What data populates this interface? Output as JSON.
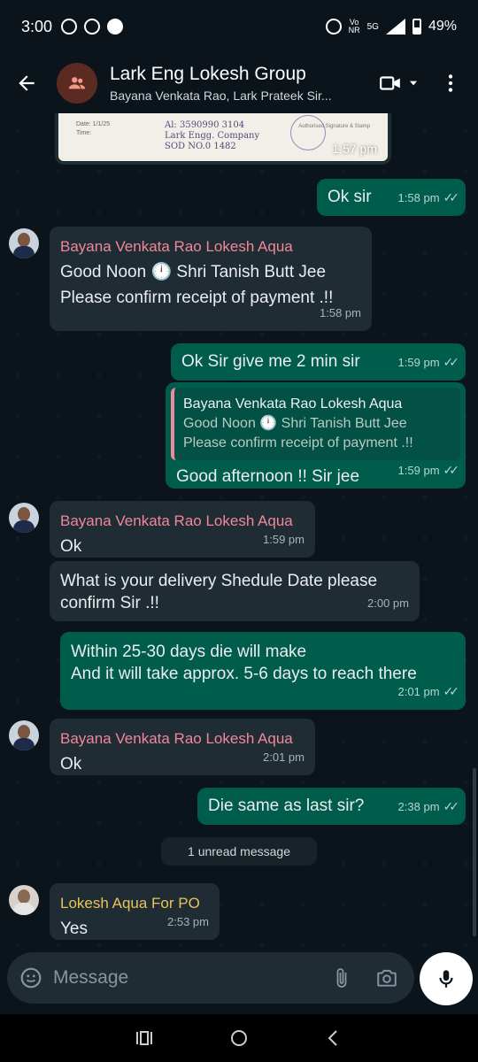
{
  "status_bar": {
    "time": "3:00",
    "network_label_1": "Vo",
    "network_label_2": "NR",
    "network_type": "5G",
    "battery": "49%"
  },
  "header": {
    "title": "Lark Eng Lokesh Group",
    "subtitle": "Bayana Venkata Rao, Lark Prateek Sir..."
  },
  "messages": [
    {
      "id": "img",
      "type": "image",
      "time": "1:57 pm",
      "image_text": "Al: 3590990 3104",
      "image_text2": "Lark Engg. Company",
      "image_text3": "SOD NO.0 1482",
      "date_label": "Date: 1/1/25",
      "time_label": "Time:",
      "sig_label": "Authorised Signature & Stamp"
    },
    {
      "id": "m1",
      "type": "out",
      "text": "Ok sir",
      "time": "1:58 pm"
    },
    {
      "id": "m2",
      "type": "in",
      "sender": "Bayana Venkata Rao Lokesh Aqua",
      "line1": "Good Noon 🕛 Shri Tanish Butt Jee",
      "line2": "Please confirm receipt of payment .!!",
      "time": "1:58 pm"
    },
    {
      "id": "m3",
      "type": "out",
      "text": "Ok Sir give me 2 min sir",
      "time": "1:59 pm"
    },
    {
      "id": "m4",
      "type": "out_reply",
      "quote_sender": "Bayana Venkata Rao Lokesh Aqua",
      "quote_line1": "Good Noon 🕛 Shri Tanish Butt Jee",
      "quote_line2": "Please confirm receipt of payment .!!",
      "text": "Good afternoon !! Sir jee",
      "time": "1:59 pm"
    },
    {
      "id": "m5",
      "type": "in",
      "sender": "Bayana Venkata Rao Lokesh Aqua",
      "text": "Ok",
      "time": "1:59 pm"
    },
    {
      "id": "m6",
      "type": "in_cont",
      "line1": "What is your delivery Shedule Date please",
      "line2": "confirm Sir .!!",
      "time": "2:00 pm"
    },
    {
      "id": "m7",
      "type": "out",
      "line1": "Within 25-30 days die will make",
      "line2": "And it will take approx. 5-6 days to reach there",
      "time": "2:01 pm"
    },
    {
      "id": "m8",
      "type": "in",
      "sender": "Bayana Venkata Rao Lokesh Aqua",
      "text": "Ok",
      "time": "2:01 pm"
    },
    {
      "id": "m9",
      "type": "out",
      "text": "Die same as last sir?",
      "time": "2:38 pm"
    },
    {
      "id": "m10",
      "type": "in",
      "sender": "Lokesh Aqua For PO",
      "text": "Yes",
      "time": "2:53 pm"
    }
  ],
  "unread_label": "1 unread message",
  "input": {
    "placeholder": "Message"
  },
  "colors": {
    "background": "#0b141a",
    "incoming_bubble": "#202c33",
    "outgoing_bubble": "#005c4b",
    "sender_pink": "#f0879a",
    "sender_gold": "#e8c35b"
  },
  "icons": [
    "back-arrow-icon",
    "group-icon",
    "video-call-icon",
    "dropdown-icon",
    "more-icon",
    "sticker-icon",
    "attach-icon",
    "camera-icon",
    "mic-icon",
    "recents-icon",
    "home-icon",
    "back-icon"
  ]
}
